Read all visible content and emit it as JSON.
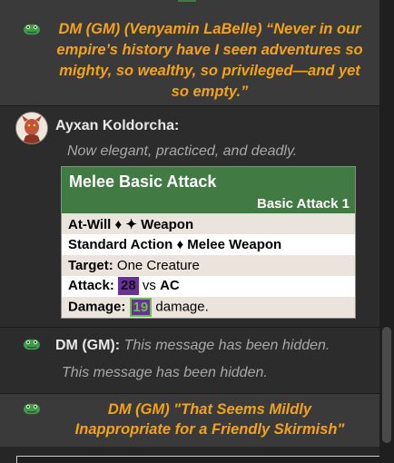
{
  "messages": {
    "emote_top": {
      "text": "DM (GM) (Venyamin LaBelle) “Never in our empire’s history have I seen adventures so mighty, so wealthy, so privileged—and yet so empty.”"
    },
    "ayxan": {
      "speaker": "Ayxan Koldorcha:",
      "desc": "Now elegant, practiced, and deadly.",
      "card": {
        "title": "Melee Basic Attack",
        "subtitle": "Basic Attack 1",
        "usage": "At-Will ♦ ✦ Weapon",
        "action": "Standard Action ♦ Melee Weapon",
        "target_label": "Target:",
        "target_value": "One Creature",
        "attack_label": "Attack:",
        "attack_roll": "28",
        "attack_vs": "vs",
        "attack_def": "AC",
        "damage_label": "Damage:",
        "damage_roll": "19",
        "damage_suffix": "damage."
      }
    },
    "hidden": {
      "speaker": "DM (GM):",
      "inline_text": "This message has been hidden.",
      "line_text": "This message has been hidden."
    },
    "emote_bottom": {
      "line1": "DM (GM) \"That Seems Mildly",
      "line2": "Inappropriate for a Friendly Skirmish\""
    }
  },
  "colors": {
    "emote": "#f3a21b",
    "card_header": "#427a43",
    "roll_bg": "#6b2f98",
    "damage_text": "#6ac04a"
  },
  "icons": {
    "gm": "gm-frog-icon",
    "avatar": "avatar"
  }
}
